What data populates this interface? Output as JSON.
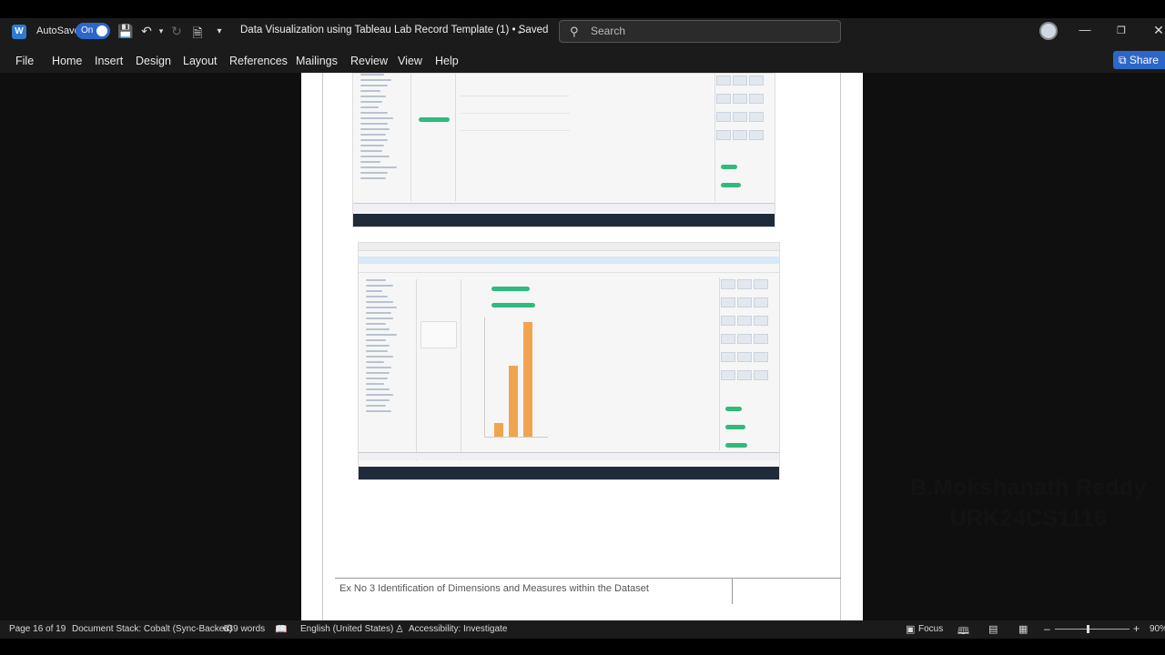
{
  "window": {
    "autosave_label": "AutoSave",
    "autosave_state": "On",
    "document_title": "Data Visualization using Tableau Lab Record Template (1) • Saved",
    "search_placeholder": "Search"
  },
  "ribbon": {
    "tabs": [
      "File",
      "Home",
      "Insert",
      "Design",
      "Layout",
      "References",
      "Mailings",
      "Review",
      "View",
      "Help"
    ],
    "share_label": "Share"
  },
  "document": {
    "footer_text": "Ex No 3 Identification of Dimensions and Measures within the Dataset",
    "embedded_screenshot_2": {
      "bar_values_relative": [
        0.12,
        0.62,
        1.0
      ],
      "bar_color": "#f1a44f"
    }
  },
  "watermark": {
    "line1": "B.Mokshanath Reddy",
    "line2": "URK24CS1116"
  },
  "statusbar": {
    "page": "Page 16 of 19",
    "document_stack": "Document Stack: Cobalt (Sync-Backed)",
    "words": "639 words",
    "language": "English (United States)",
    "accessibility": "Accessibility: Investigate",
    "focus": "Focus",
    "zoom": "90%"
  },
  "colors": {
    "accent": "#2c66c9",
    "titlebar_bg": "#1b1b1b",
    "page_bg": "#ffffff"
  }
}
